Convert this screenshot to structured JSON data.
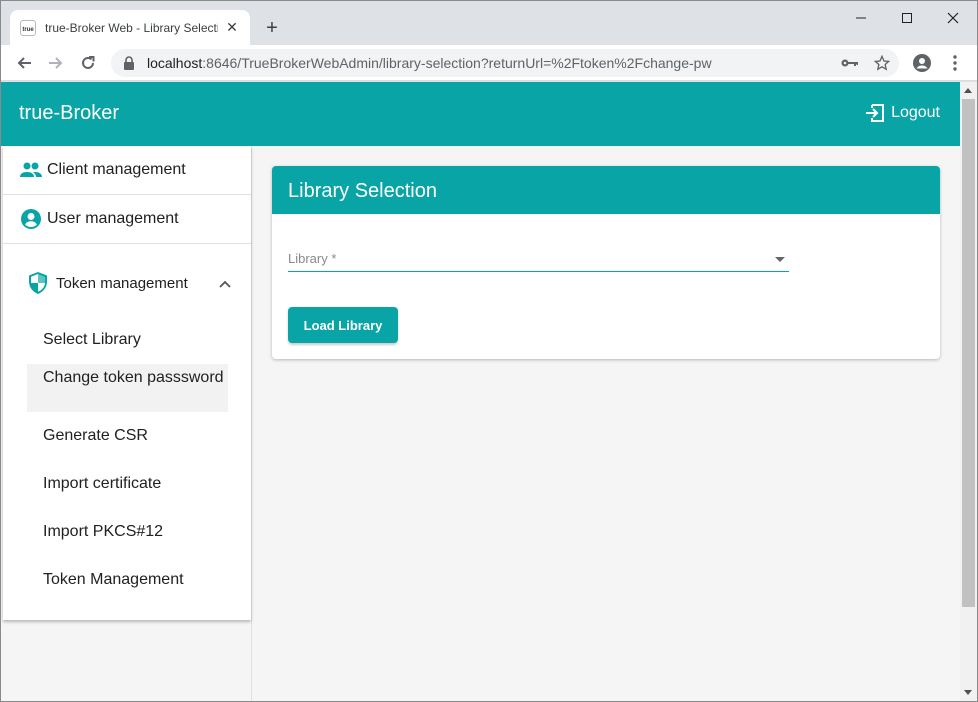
{
  "browser": {
    "tab_title": "true-Broker Web - Library Selection",
    "favicon_text": "true",
    "url_host": "localhost",
    "url_rest": ":8646/TrueBrokerWebAdmin/library-selection?returnUrl=%2Ftoken%2Fchange-pw",
    "new_tab": "+",
    "close_tab": "✕"
  },
  "appbar": {
    "brand": "true-Broker",
    "logout_label": "Logout"
  },
  "sidebar": {
    "items": [
      {
        "label": "Client management",
        "icon": "people-icon"
      },
      {
        "label": "User management",
        "icon": "account-circle-icon"
      }
    ],
    "token_group": {
      "label": "Token management",
      "icon": "shield-icon",
      "expanded": true
    },
    "sub_items": [
      {
        "label": "Select Library",
        "active": false
      },
      {
        "label": "Change token passsword",
        "active": true
      },
      {
        "label": "Generate CSR",
        "active": false
      },
      {
        "label": "Import certificate",
        "active": false
      },
      {
        "label": "Import PKCS#12",
        "active": false
      },
      {
        "label": "Token Management",
        "active": false
      }
    ]
  },
  "card": {
    "title": "Library Selection",
    "library_field_label": "Library *",
    "load_button": "Load Library"
  },
  "colors": {
    "primary": "#08a4a6",
    "background": "#f5f5f5"
  }
}
